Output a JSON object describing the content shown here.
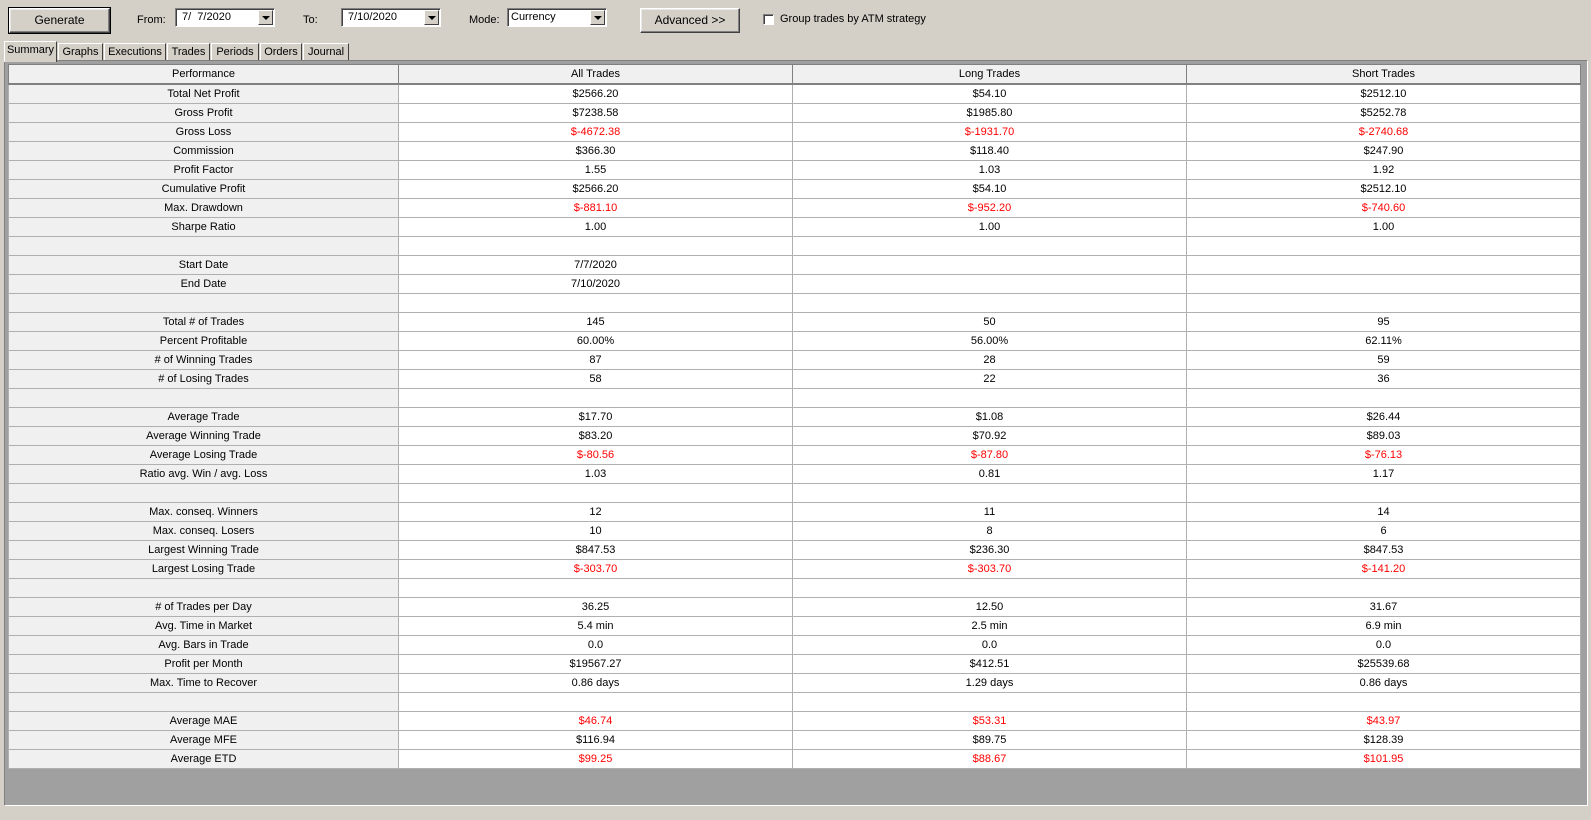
{
  "toolbar": {
    "generate_label": "Generate",
    "from_label": "From:",
    "from_value": "7/  7/2020",
    "to_label": "To:",
    "to_value": "7/10/2020",
    "mode_label": "Mode:",
    "mode_value": "Currency",
    "advanced_label": "Advanced >>",
    "group_trades_label": "Group trades by ATM strategy",
    "group_trades_checked": false
  },
  "tabs": [
    {
      "label": "Summary",
      "active": true
    },
    {
      "label": "Graphs",
      "active": false
    },
    {
      "label": "Executions",
      "active": false
    },
    {
      "label": "Trades",
      "active": false
    },
    {
      "label": "Periods",
      "active": false
    },
    {
      "label": "Orders",
      "active": false
    },
    {
      "label": "Journal",
      "active": false
    }
  ],
  "colors": {
    "negative": "#ff0000",
    "background": "#d4d0c8"
  },
  "table": {
    "headers": [
      "Performance",
      "All Trades",
      "Long Trades",
      "Short Trades"
    ],
    "rows": [
      {
        "label": "Total Net Profit",
        "values": [
          "$2566.20",
          "$54.10",
          "$2512.10"
        ]
      },
      {
        "label": "Gross Profit",
        "values": [
          "$7238.58",
          "$1985.80",
          "$5252.78"
        ]
      },
      {
        "label": "Gross Loss",
        "values": [
          "$-4672.38",
          "$-1931.70",
          "$-2740.68"
        ],
        "negative": true
      },
      {
        "label": "Commission",
        "values": [
          "$366.30",
          "$118.40",
          "$247.90"
        ]
      },
      {
        "label": "Profit Factor",
        "values": [
          "1.55",
          "1.03",
          "1.92"
        ]
      },
      {
        "label": "Cumulative Profit",
        "values": [
          "$2566.20",
          "$54.10",
          "$2512.10"
        ]
      },
      {
        "label": "Max. Drawdown",
        "values": [
          "$-881.10",
          "$-952.20",
          "$-740.60"
        ],
        "negative": true
      },
      {
        "label": "Sharpe Ratio",
        "values": [
          "1.00",
          "1.00",
          "1.00"
        ]
      },
      {
        "label": "",
        "values": [
          "",
          "",
          ""
        ]
      },
      {
        "label": "Start Date",
        "values": [
          "7/7/2020",
          "",
          ""
        ]
      },
      {
        "label": "End Date",
        "values": [
          "7/10/2020",
          "",
          ""
        ]
      },
      {
        "label": "",
        "values": [
          "",
          "",
          ""
        ]
      },
      {
        "label": "Total # of Trades",
        "values": [
          "145",
          "50",
          "95"
        ]
      },
      {
        "label": "Percent Profitable",
        "values": [
          "60.00%",
          "56.00%",
          "62.11%"
        ]
      },
      {
        "label": "# of Winning Trades",
        "values": [
          "87",
          "28",
          "59"
        ]
      },
      {
        "label": "# of Losing Trades",
        "values": [
          "58",
          "22",
          "36"
        ]
      },
      {
        "label": "",
        "values": [
          "",
          "",
          ""
        ]
      },
      {
        "label": "Average Trade",
        "values": [
          "$17.70",
          "$1.08",
          "$26.44"
        ]
      },
      {
        "label": "Average Winning Trade",
        "values": [
          "$83.20",
          "$70.92",
          "$89.03"
        ]
      },
      {
        "label": "Average Losing Trade",
        "values": [
          "$-80.56",
          "$-87.80",
          "$-76.13"
        ],
        "negative": true
      },
      {
        "label": "Ratio avg. Win / avg. Loss",
        "values": [
          "1.03",
          "0.81",
          "1.17"
        ]
      },
      {
        "label": "",
        "values": [
          "",
          "",
          ""
        ]
      },
      {
        "label": "Max. conseq. Winners",
        "values": [
          "12",
          "11",
          "14"
        ]
      },
      {
        "label": "Max. conseq. Losers",
        "values": [
          "10",
          "8",
          "6"
        ]
      },
      {
        "label": "Largest Winning Trade",
        "values": [
          "$847.53",
          "$236.30",
          "$847.53"
        ]
      },
      {
        "label": "Largest Losing Trade",
        "values": [
          "$-303.70",
          "$-303.70",
          "$-141.20"
        ],
        "negative": true
      },
      {
        "label": "",
        "values": [
          "",
          "",
          ""
        ]
      },
      {
        "label": "# of Trades per Day",
        "values": [
          "36.25",
          "12.50",
          "31.67"
        ]
      },
      {
        "label": "Avg. Time in Market",
        "values": [
          "5.4 min",
          "2.5 min",
          "6.9 min"
        ]
      },
      {
        "label": "Avg. Bars in Trade",
        "values": [
          "0.0",
          "0.0",
          "0.0"
        ]
      },
      {
        "label": "Profit per Month",
        "values": [
          "$19567.27",
          "$412.51",
          "$25539.68"
        ]
      },
      {
        "label": "Max. Time to Recover",
        "values": [
          "0.86 days",
          "1.29 days",
          "0.86 days"
        ]
      },
      {
        "label": "",
        "values": [
          "",
          "",
          ""
        ]
      },
      {
        "label": "Average MAE",
        "values": [
          "$46.74",
          "$53.31",
          "$43.97"
        ],
        "negative": true
      },
      {
        "label": "Average MFE",
        "values": [
          "$116.94",
          "$89.75",
          "$128.39"
        ]
      },
      {
        "label": "Average ETD",
        "values": [
          "$99.25",
          "$88.67",
          "$101.95"
        ],
        "negative": true
      }
    ]
  }
}
